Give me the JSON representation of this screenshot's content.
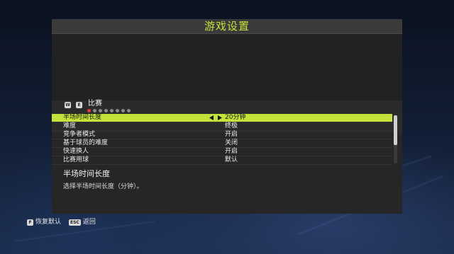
{
  "window": {
    "title": "游戏设置"
  },
  "category": {
    "prev_key": "W",
    "next_key": "E",
    "label": "比赛",
    "page_count": 8,
    "active_page": 1
  },
  "settings": {
    "rows": [
      {
        "label": "半场时间长度",
        "value": "20分钟"
      },
      {
        "label": "难度",
        "value": "终极"
      },
      {
        "label": "竞争者模式",
        "value": "开启"
      },
      {
        "label": "基于球员的难度",
        "value": "关闭"
      },
      {
        "label": "快速换人",
        "value": "开启"
      },
      {
        "label": "比赛用球",
        "value": "默认"
      }
    ],
    "selected_index": 0
  },
  "description": {
    "title": "半场时间长度",
    "text": "选择半场时间长度（分钟）。"
  },
  "footer": {
    "restore_key": "F",
    "restore_label": "恢复默认",
    "back_key": "ESC",
    "back_label": "返回"
  },
  "colors": {
    "accent": "#c3e23a",
    "active_dot": "#e03a3a"
  },
  "icons": {
    "value_arrows": "left-right-arrow-icon"
  }
}
